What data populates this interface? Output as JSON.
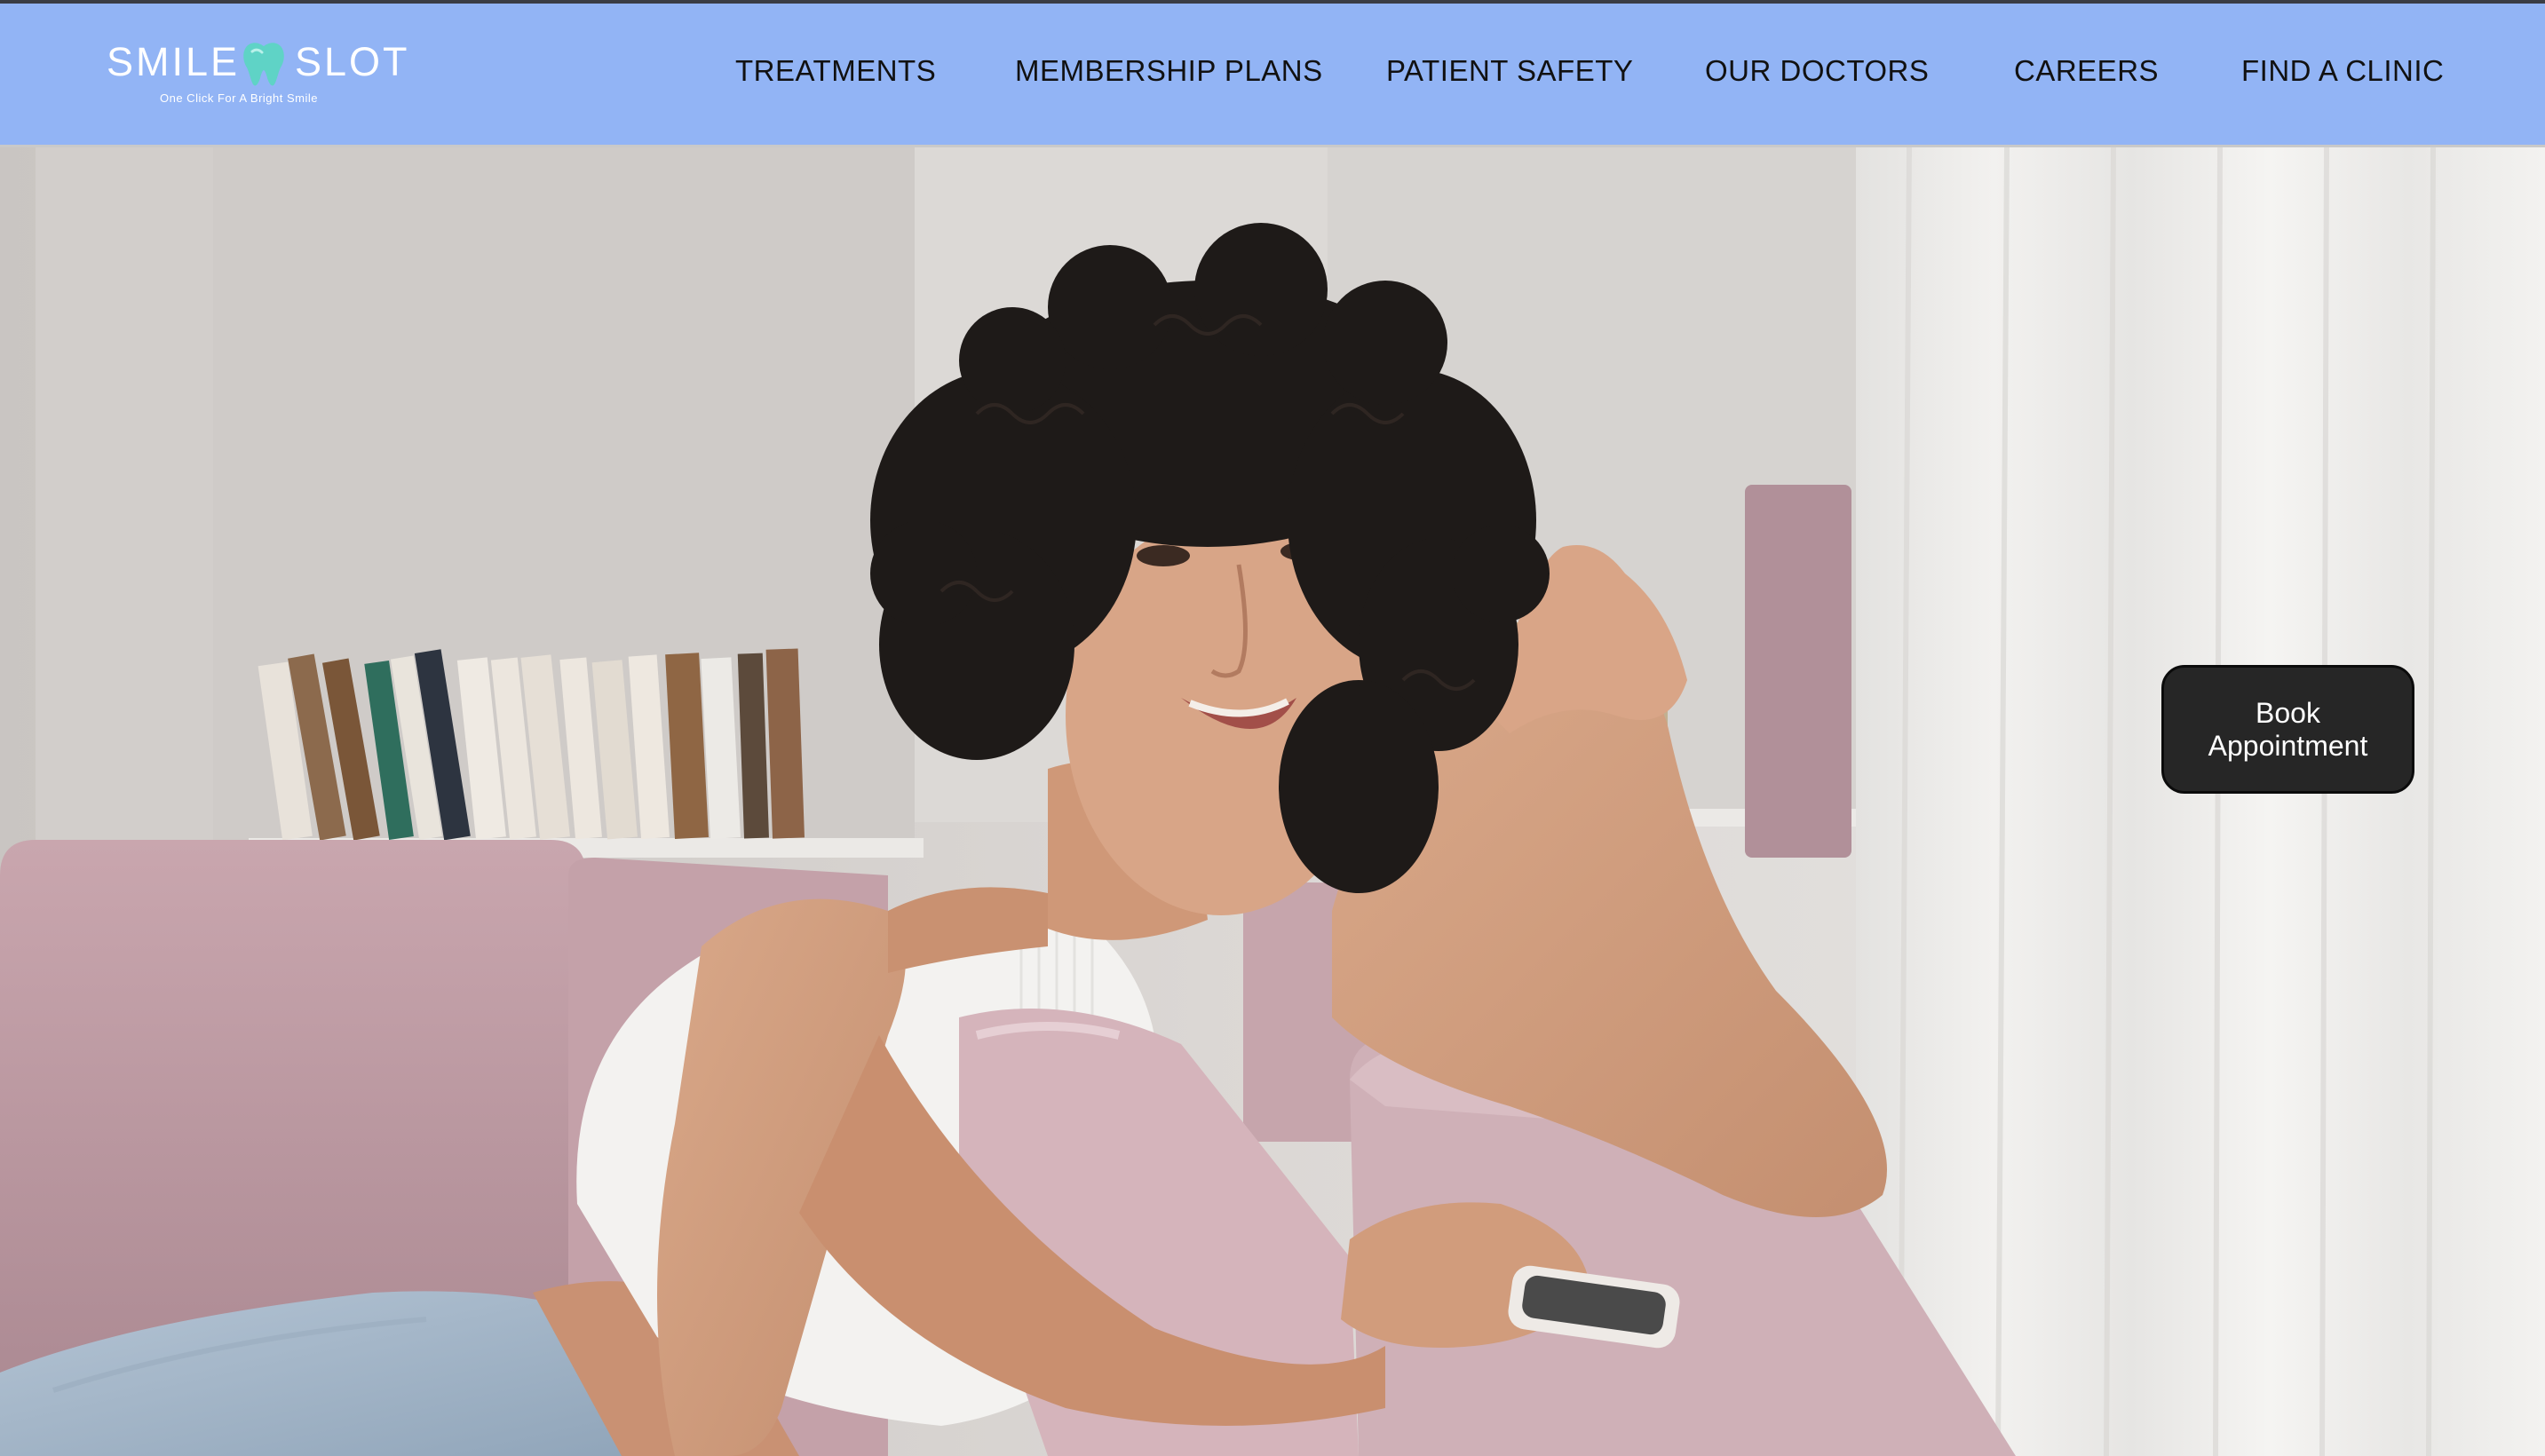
{
  "brand": {
    "name_left": "SMILE",
    "name_right": "SLOT",
    "tagline": "One Click For A Bright Smile",
    "logo_icon": "tooth-icon",
    "logo_icon_color": "#5fd3c6"
  },
  "nav": {
    "items": [
      {
        "label": "TREATMENTS"
      },
      {
        "label": "MEMBERSHIP PLANS"
      },
      {
        "label": "PATIENT SAFETY"
      },
      {
        "label": "OUR DOCTORS"
      },
      {
        "label": "CAREERS"
      },
      {
        "label": "FIND A CLINIC"
      }
    ]
  },
  "hero": {
    "cta_label": "Book Appointment"
  },
  "colors": {
    "header_bg": "#92b4f5",
    "nav_text": "#111111",
    "cta_bg": "#262626",
    "cta_text": "#ffffff"
  }
}
